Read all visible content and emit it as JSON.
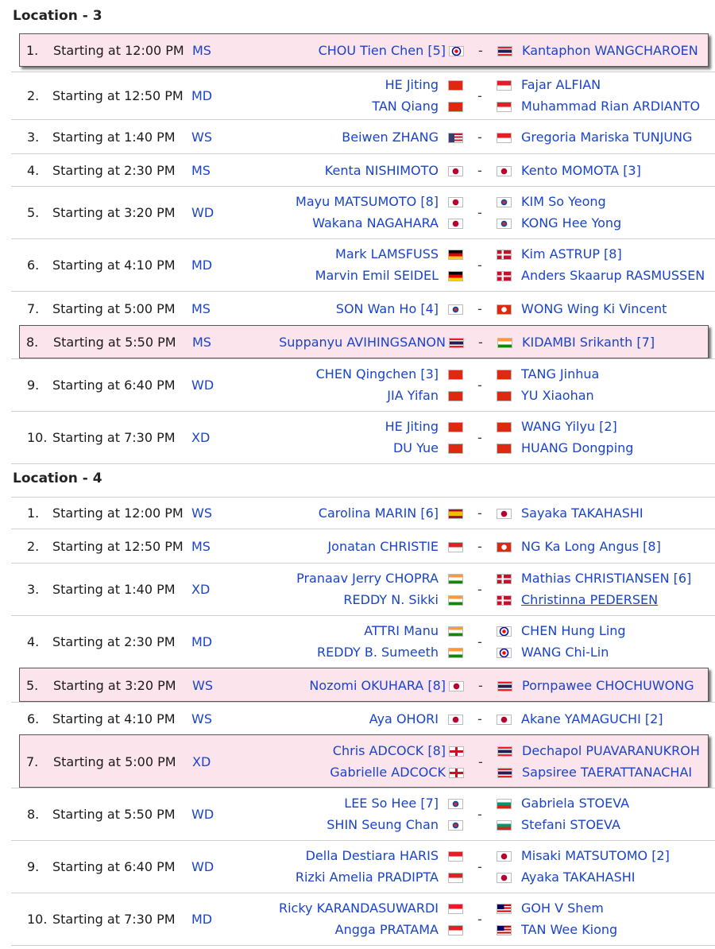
{
  "locations": [
    {
      "title": "Location - 3",
      "matches": [
        {
          "num": "1.",
          "time": "Starting at 12:00 PM",
          "event": "MS",
          "highlighted": true,
          "left": [
            {
              "name": "CHOU Tien Chen [5]",
              "flag": "tw"
            }
          ],
          "right": [
            {
              "name": "Kantaphon WANGCHAROEN",
              "flag": "th"
            }
          ]
        },
        {
          "num": "2.",
          "time": "Starting at 12:50 PM",
          "event": "MD",
          "highlighted": false,
          "left": [
            {
              "name": "HE Jiting",
              "flag": "cn"
            },
            {
              "name": "TAN Qiang",
              "flag": "cn"
            }
          ],
          "right": [
            {
              "name": "Fajar ALFIAN",
              "flag": "id"
            },
            {
              "name": "Muhammad Rian ARDIANTO",
              "flag": "id"
            }
          ]
        },
        {
          "num": "3.",
          "time": "Starting at 1:40 PM",
          "event": "WS",
          "highlighted": false,
          "left": [
            {
              "name": "Beiwen ZHANG",
              "flag": "us"
            }
          ],
          "right": [
            {
              "name": "Gregoria Mariska TUNJUNG",
              "flag": "id"
            }
          ]
        },
        {
          "num": "4.",
          "time": "Starting at 2:30 PM",
          "event": "MS",
          "highlighted": false,
          "left": [
            {
              "name": "Kenta NISHIMOTO",
              "flag": "jp"
            }
          ],
          "right": [
            {
              "name": "Kento MOMOTA [3]",
              "flag": "jp"
            }
          ]
        },
        {
          "num": "5.",
          "time": "Starting at 3:20 PM",
          "event": "WD",
          "highlighted": false,
          "left": [
            {
              "name": "Mayu MATSUMOTO [8]",
              "flag": "jp"
            },
            {
              "name": "Wakana NAGAHARA",
              "flag": "jp"
            }
          ],
          "right": [
            {
              "name": "KIM So Yeong",
              "flag": "kr"
            },
            {
              "name": "KONG Hee Yong",
              "flag": "kr"
            }
          ]
        },
        {
          "num": "6.",
          "time": "Starting at 4:10 PM",
          "event": "MD",
          "highlighted": false,
          "left": [
            {
              "name": "Mark LAMSFUSS",
              "flag": "de"
            },
            {
              "name": "Marvin Emil SEIDEL",
              "flag": "de"
            }
          ],
          "right": [
            {
              "name": "Kim ASTRUP [8]",
              "flag": "dk"
            },
            {
              "name": "Anders Skaarup RASMUSSEN",
              "flag": "dk"
            }
          ]
        },
        {
          "num": "7.",
          "time": "Starting at 5:00 PM",
          "event": "MS",
          "highlighted": false,
          "left": [
            {
              "name": "SON Wan Ho [4]",
              "flag": "kr"
            }
          ],
          "right": [
            {
              "name": "WONG Wing Ki Vincent",
              "flag": "hk"
            }
          ]
        },
        {
          "num": "8.",
          "time": "Starting at 5:50 PM",
          "event": "MS",
          "highlighted": true,
          "left": [
            {
              "name": "Suppanyu AVIHINGSANON",
              "flag": "th"
            }
          ],
          "right": [
            {
              "name": "KIDAMBI Srikanth [7]",
              "flag": "in"
            }
          ]
        },
        {
          "num": "9.",
          "time": "Starting at 6:40 PM",
          "event": "WD",
          "highlighted": false,
          "left": [
            {
              "name": "CHEN Qingchen [3]",
              "flag": "cn"
            },
            {
              "name": "JIA Yifan",
              "flag": "cn"
            }
          ],
          "right": [
            {
              "name": "TANG Jinhua",
              "flag": "cn"
            },
            {
              "name": "YU Xiaohan",
              "flag": "cn"
            }
          ]
        },
        {
          "num": "10.",
          "time": "Starting at 7:30 PM",
          "event": "XD",
          "highlighted": false,
          "left": [
            {
              "name": "HE Jiting",
              "flag": "cn"
            },
            {
              "name": "DU Yue",
              "flag": "cn"
            }
          ],
          "right": [
            {
              "name": "WANG Yilyu [2]",
              "flag": "cn"
            },
            {
              "name": "HUANG Dongping",
              "flag": "cn"
            }
          ]
        }
      ]
    },
    {
      "title": "Location - 4",
      "matches": [
        {
          "num": "1.",
          "time": "Starting at 12:00 PM",
          "event": "WS",
          "highlighted": false,
          "left": [
            {
              "name": "Carolina MARIN [6]",
              "flag": "es"
            }
          ],
          "right": [
            {
              "name": "Sayaka TAKAHASHI",
              "flag": "jp"
            }
          ]
        },
        {
          "num": "2.",
          "time": "Starting at 12:50 PM",
          "event": "MS",
          "highlighted": false,
          "left": [
            {
              "name": "Jonatan CHRISTIE",
              "flag": "id"
            }
          ],
          "right": [
            {
              "name": "NG Ka Long Angus [8]",
              "flag": "hk"
            }
          ]
        },
        {
          "num": "3.",
          "time": "Starting at 1:40 PM",
          "event": "XD",
          "highlighted": false,
          "left": [
            {
              "name": "Pranaav Jerry CHOPRA",
              "flag": "in"
            },
            {
              "name": "REDDY N. Sikki",
              "flag": "in"
            }
          ],
          "right": [
            {
              "name": "Mathias CHRISTIANSEN [6]",
              "flag": "dk"
            },
            {
              "name": "Christinna PEDERSEN",
              "flag": "dk",
              "underline": true
            }
          ]
        },
        {
          "num": "4.",
          "time": "Starting at 2:30 PM",
          "event": "MD",
          "highlighted": false,
          "left": [
            {
              "name": "ATTRI Manu",
              "flag": "in"
            },
            {
              "name": "REDDY B. Sumeeth",
              "flag": "in"
            }
          ],
          "right": [
            {
              "name": "CHEN Hung Ling",
              "flag": "tw"
            },
            {
              "name": "WANG Chi-Lin",
              "flag": "tw"
            }
          ]
        },
        {
          "num": "5.",
          "time": "Starting at 3:20 PM",
          "event": "WS",
          "highlighted": true,
          "left": [
            {
              "name": "Nozomi OKUHARA [8]",
              "flag": "jp"
            }
          ],
          "right": [
            {
              "name": "Pornpawee CHOCHUWONG",
              "flag": "th"
            }
          ]
        },
        {
          "num": "6.",
          "time": "Starting at 4:10 PM",
          "event": "WS",
          "highlighted": false,
          "left": [
            {
              "name": "Aya OHORI",
              "flag": "jp"
            }
          ],
          "right": [
            {
              "name": "Akane YAMAGUCHI [2]",
              "flag": "jp"
            }
          ]
        },
        {
          "num": "7.",
          "time": "Starting at 5:00 PM",
          "event": "XD",
          "highlighted": true,
          "left": [
            {
              "name": "Chris ADCOCK [8]",
              "flag": "gb"
            },
            {
              "name": "Gabrielle ADCOCK",
              "flag": "gb"
            }
          ],
          "right": [
            {
              "name": "Dechapol PUAVARANUKROH",
              "flag": "th"
            },
            {
              "name": "Sapsiree TAERATTANACHAI",
              "flag": "th"
            }
          ]
        },
        {
          "num": "8.",
          "time": "Starting at 5:50 PM",
          "event": "WD",
          "highlighted": false,
          "left": [
            {
              "name": "LEE So Hee [7]",
              "flag": "kr"
            },
            {
              "name": "SHIN Seung Chan",
              "flag": "kr"
            }
          ],
          "right": [
            {
              "name": "Gabriela STOEVA",
              "flag": "bg"
            },
            {
              "name": "Stefani STOEVA",
              "flag": "bg"
            }
          ]
        },
        {
          "num": "9.",
          "time": "Starting at 6:40 PM",
          "event": "WD",
          "highlighted": false,
          "left": [
            {
              "name": "Della Destiara HARIS",
              "flag": "id"
            },
            {
              "name": "Rizki Amelia PRADIPTA",
              "flag": "id"
            }
          ],
          "right": [
            {
              "name": "Misaki MATSUTOMO [2]",
              "flag": "jp"
            },
            {
              "name": "Ayaka TAKAHASHI",
              "flag": "jp"
            }
          ]
        },
        {
          "num": "10.",
          "time": "Starting at 7:30 PM",
          "event": "MD",
          "highlighted": false,
          "left": [
            {
              "name": "Ricky KARANDASUWARDI",
              "flag": "id"
            },
            {
              "name": "Angga PRATAMA",
              "flag": "id"
            }
          ],
          "right": [
            {
              "name": "GOH V Shem",
              "flag": "my"
            },
            {
              "name": "TAN Wee Kiong",
              "flag": "my"
            }
          ]
        }
      ]
    }
  ],
  "separator": "-",
  "colors": {
    "link": "#1a44c8",
    "highlight": "#fce4ec",
    "divider": "#d0d0d0"
  }
}
